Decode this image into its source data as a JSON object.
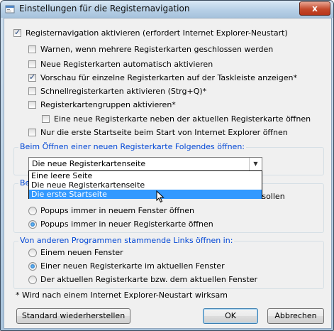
{
  "window": {
    "title": "Einstellungen für die Registernavigation",
    "close_label": "x"
  },
  "options": {
    "main": "Registernavigation aktivieren (erfordert Internet Explorer-Neustart)",
    "warn": "Warnen, wenn mehrere Registerkarten geschlossen werden",
    "auto_new": "Neue Registerkarten automatisch aktivieren",
    "preview": "Vorschau für einzelne Registerkarten auf der Taskleiste anzeigen*",
    "quick": "Schnellregisterkarten aktivieren (Strg+Q)*",
    "groups": "Registerkartengruppen aktivieren*",
    "open_next": "Eine neue Registerkarte neben der aktuellen Registerkarte öffnen",
    "first_home": "Nur die erste Startseite beim Start von Internet Explorer öffnen"
  },
  "new_tab_group": {
    "title": "Beim Öffnen einer neuen Registerkarte Folgendes öffnen:",
    "selected": "Die neue Registerkartenseite",
    "options": [
      "Eine leere Seite",
      "Die neue Registerkartenseite",
      "Die erste Startseite"
    ]
  },
  "popup_group": {
    "title_fragment": "Be",
    "option1_fragment": "llen sollen",
    "option2": "Popups immer in neuem Fenster öffnen",
    "option3": "Popups immer in neuer Registerkarte öffnen"
  },
  "links_group": {
    "title": "Von anderen Programmen stammende Links öffnen in:",
    "option1": "Einem neuen Fenster",
    "option2": "Einer neuen Registerkarte im aktuellen Fenster",
    "option3": "Der aktuellen Registerkarte bzw. dem aktuellen Fenster"
  },
  "footnote": "* Wird nach einem Internet Explorer-Neustart wirksam",
  "buttons": {
    "restore": "Standard wiederherstellen",
    "ok": "OK",
    "cancel": "Abbrechen"
  },
  "colors": {
    "group_title": "#0046d5",
    "selection": "#3399ff"
  }
}
